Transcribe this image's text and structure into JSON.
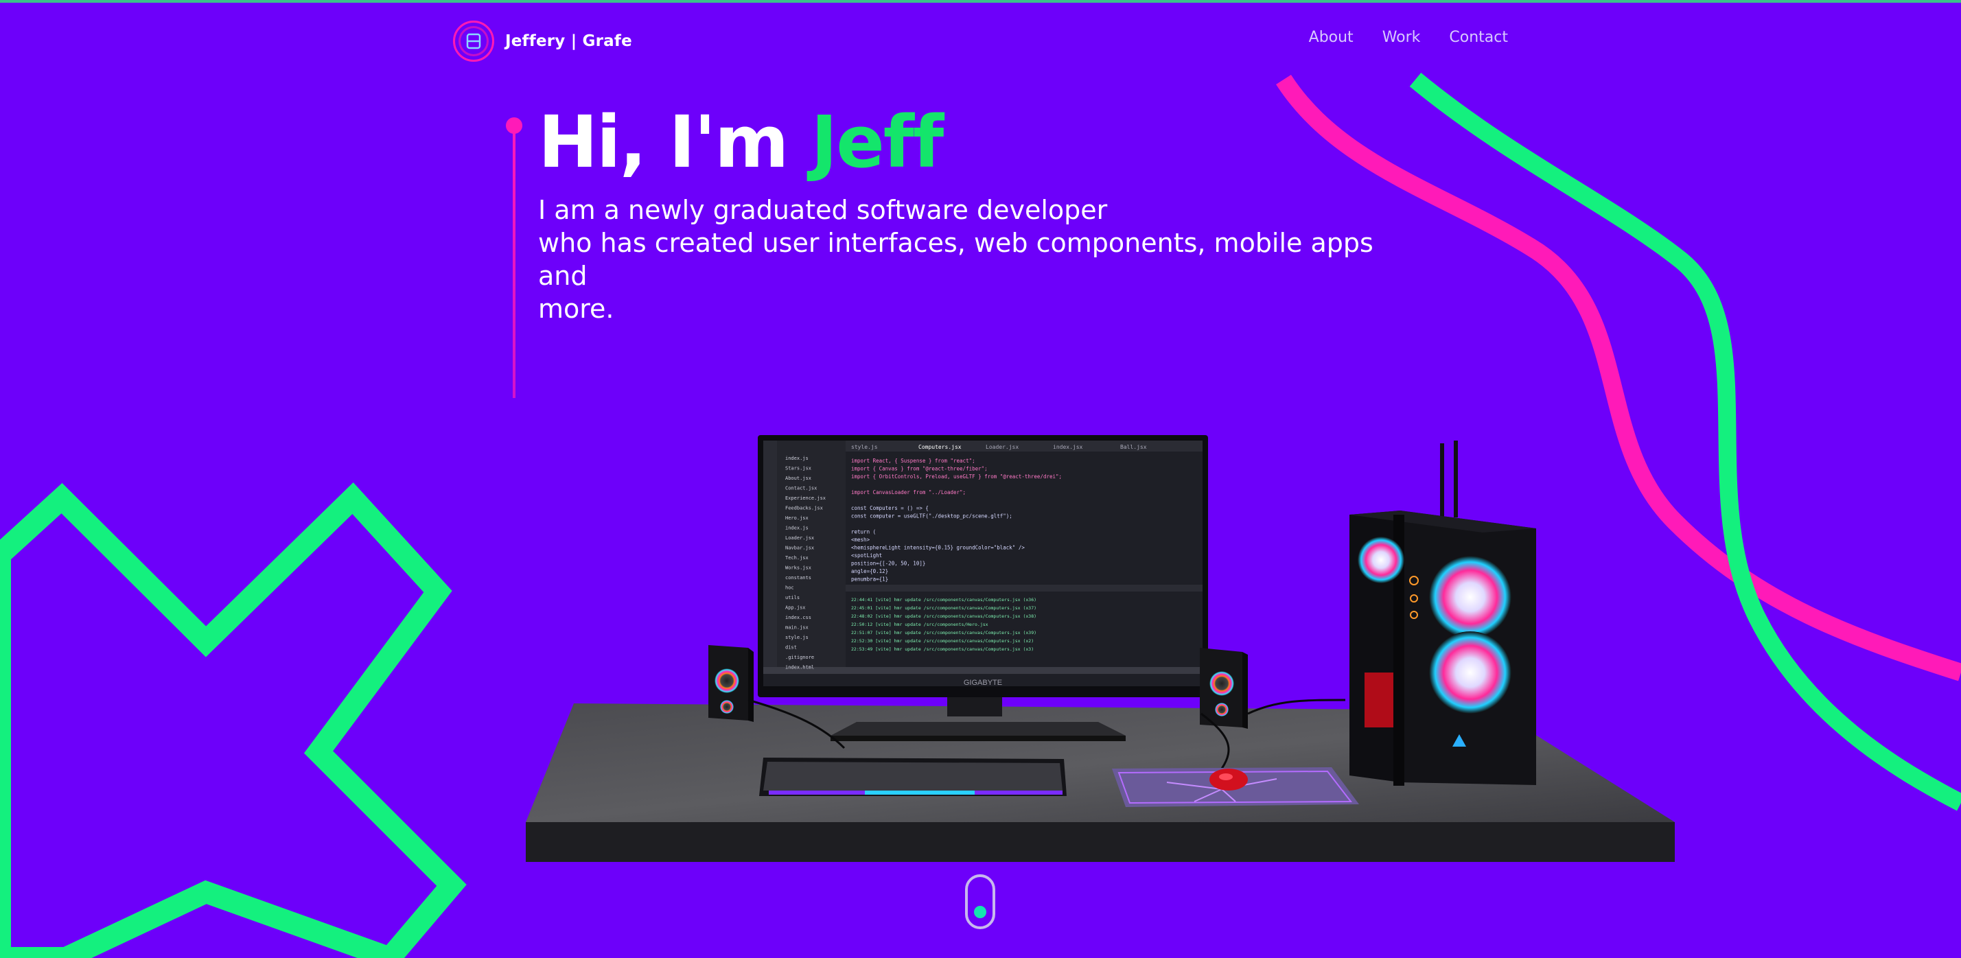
{
  "brand": {
    "name": "Jeffery | Grafe",
    "icon": "logo-monogram-icon"
  },
  "nav": {
    "items": [
      "About",
      "Work",
      "Contact"
    ]
  },
  "hero": {
    "greeting": "Hi, I'm",
    "name": "Jeff",
    "intro_lines": [
      "I am a newly graduated software developer",
      "who has created user interfaces, web components, mobile apps and",
      "more."
    ]
  },
  "scene": {
    "monitor_brand": "GIGABYTE",
    "editor_tabs": [
      "style.js",
      "Computers.jsx",
      "Loader.jsx",
      "index.jsx",
      "Ball.jsx"
    ],
    "explorer_files": [
      "index.js",
      "Stars.jsx",
      "About.jsx",
      "Contact.jsx",
      "Experience.jsx",
      "Feedbacks.jsx",
      "Hero.jsx",
      "index.js",
      "Loader.jsx",
      "Navbar.jsx",
      "Tech.jsx",
      "Works.jsx",
      "constants",
      "hoc",
      "utils",
      "App.jsx",
      "index.css",
      "main.jsx",
      "style.js",
      "dist",
      ".gitignore",
      "index.html"
    ],
    "code_lines": [
      "import React, { Suspense } from \"react\";",
      "import { Canvas } from \"@react-three/fiber\";",
      "import { OrbitControls, Preload, useGLTF } from \"@react-three/drei\";",
      "",
      "import CanvasLoader from \"../Loader\";",
      "",
      "const Computers = () => {",
      "  const computer = useGLTF(\"./desktop_pc/scene.gltf\");",
      "",
      "  return (",
      "    <mesh>",
      "      <hemisphereLight intensity={0.15} groundColor=\"black\" />",
      "      <spotLight",
      "        position={[-20, 50, 10]}",
      "        angle={0.12}",
      "        penumbra={1}"
    ],
    "terminal_lines": [
      "22:44:41 [vite] hmr update /src/components/canvas/Computers.jsx (x36)",
      "22:45:01 [vite] hmr update /src/components/canvas/Computers.jsx (x37)",
      "22:48:02 [vite] hmr update /src/components/canvas/Computers.jsx (x38)",
      "22:50:12 [vite] hmr update /src/components/Hero.jsx",
      "22:51:07 [vite] hmr update /src/components/canvas/Computers.jsx (x39)",
      "22:52:30 [vite] hmr update /src/components/canvas/Computers.jsx (x2)",
      "22:53:49 [vite] hmr update /src/components/canvas/Computers.jsx (x3)"
    ]
  },
  "scroll_indicator": {
    "icon": "scroll-down-indicator"
  },
  "colors": {
    "background": "#6d00fa",
    "accent_green": "#14e56b",
    "accent_pink": "#ff1ab3",
    "nav_text": "#d8c9ff"
  }
}
